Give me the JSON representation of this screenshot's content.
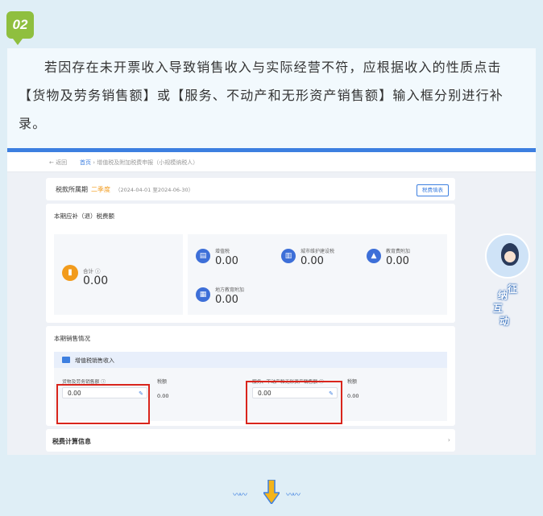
{
  "step": {
    "number": "02"
  },
  "instruction": "若因存在未开票收入导致销售收入与实际经营不符，应根据收入的性质点击【货物及劳务销售额】或【服务、不动产和无形资产销售额】输入框分别进行补录。",
  "screenshot": {
    "nav": {
      "back_label": "返回",
      "crumb_home": "首页",
      "crumb_current": "增值税及附加税费申报（小规模纳税人）"
    },
    "period": {
      "label": "税款所属期",
      "season": "二季度",
      "dates": "（2024-04-01 至2024-06-30）",
      "button": "税费填表"
    },
    "tax_section": {
      "title": "本期应补（退）税费额",
      "total": {
        "name": "合计",
        "value": "0.00"
      },
      "items": [
        {
          "name": "增值税",
          "value": "0.00"
        },
        {
          "name": "城市维护建设税",
          "value": "0.00"
        },
        {
          "name": "教育费附加",
          "value": "0.00"
        },
        {
          "name": "地方教育附加",
          "value": "0.00"
        }
      ]
    },
    "sales_section": {
      "title": "本期销售情况",
      "subtitle": "增值税销售收入",
      "goods": {
        "label": "货物及劳务销售额",
        "value": "0.00",
        "tax_label": "税额",
        "tax_value": "0.00"
      },
      "services": {
        "label": "服务、不动产和无形资产销售额",
        "value": "0.00",
        "tax_label": "税额",
        "tax_value": "0.00"
      }
    },
    "calc_section": {
      "title": "税费计算信息"
    }
  },
  "mascot": {
    "chars": [
      "征",
      "纳",
      "互",
      "动"
    ]
  },
  "colors": {
    "accent": "#3d7fe0",
    "highlight": "#d9251c",
    "badge": "#8fbf3f",
    "season": "#f29b1c"
  }
}
